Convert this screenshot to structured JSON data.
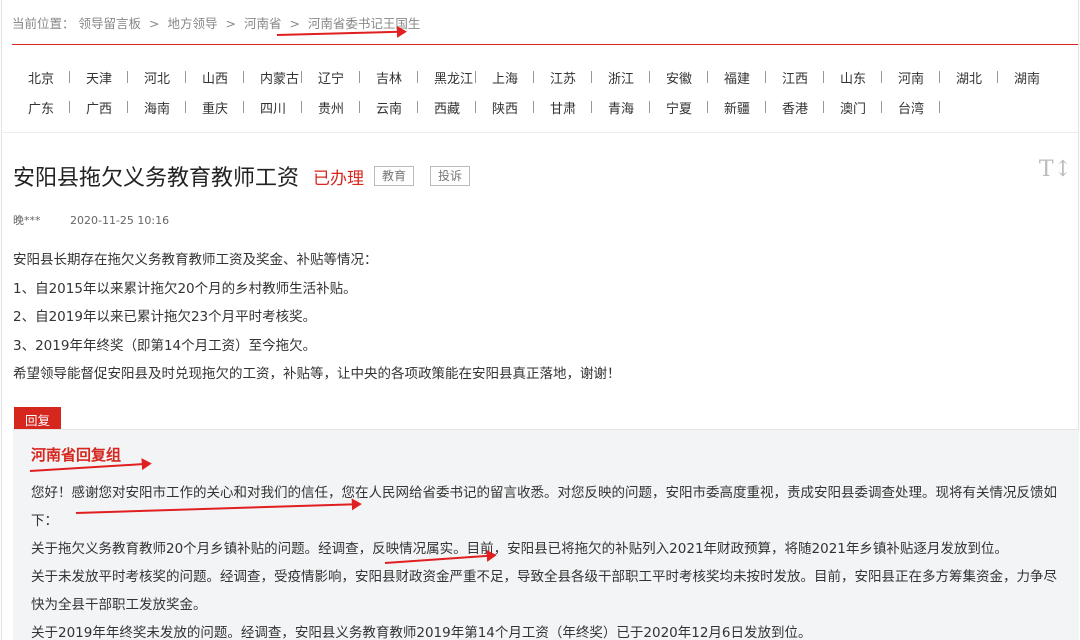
{
  "breadcrumb": {
    "label": "当前位置：",
    "items": [
      "领导留言板",
      "地方领导",
      "河南省",
      "河南省委书记王国生"
    ],
    "separator": ">"
  },
  "regions": {
    "row1": [
      "北京",
      "天津",
      "河北",
      "山西",
      "内蒙古",
      "辽宁",
      "吉林",
      "黑龙江",
      "上海",
      "江苏",
      "浙江",
      "安徽",
      "福建",
      "江西",
      "山东",
      "河南",
      "湖北",
      "湖南"
    ],
    "row2": [
      "广东",
      "广西",
      "海南",
      "重庆",
      "四川",
      "贵州",
      "云南",
      "西藏",
      "陕西",
      "甘肃",
      "青海",
      "宁夏",
      "新疆",
      "香港",
      "澳门",
      "台湾"
    ]
  },
  "message": {
    "title": "安阳县拖欠义务教育教师工资",
    "status": "已办理",
    "tags": [
      "教育",
      "投诉"
    ],
    "font_toggle": "T↕",
    "author": "晚***",
    "time": "2020-11-25 10:16",
    "paragraphs": [
      "安阳县长期存在拖欠义务教育教师工资及奖金、补贴等情况：",
      "1、自2015年以来累计拖欠20个月的乡村教师生活补贴。",
      "2、自2019年以来已累计拖欠23个月平时考核奖。",
      "3、2019年年终奖（即第14个月工资）至今拖欠。",
      "希望领导能督促安阳县及时兑现拖欠的工资，补贴等，让中央的各项政策能在安阳县真正落地，谢谢！"
    ]
  },
  "reply": {
    "tab_label": "回复",
    "org": "河南省回复组",
    "paragraphs": [
      "您好！感谢您对安阳市工作的关心和对我们的信任，您在人民网给省委书记的留言收悉。对您反映的问题，安阳市委高度重视，责成安阳县委调查处理。现将有关情况反馈如下：",
      "关于拖欠义务教育教师20个月乡镇补贴的问题。经调查，反映情况属实。目前，安阳县已将拖欠的补贴列入2021年财政预算，将随2021年乡镇补贴逐月发放到位。",
      "关于未发放平时考核奖的问题。经调查，受疫情影响，安阳县财政资金严重不足，导致全县各级干部职工平时考核奖均未按时发放。目前，安阳县正在多方筹集资金，力争尽快为全县干部职工发放奖金。",
      "关于2019年年终奖未发放的问题。经调查，安阳县义务教育教师2019年第14个月工资（年终奖）已于2020年12月6日发放到位。"
    ]
  },
  "colors": {
    "accent": "#d6271f",
    "reply_bg": "#f3f4f6"
  }
}
